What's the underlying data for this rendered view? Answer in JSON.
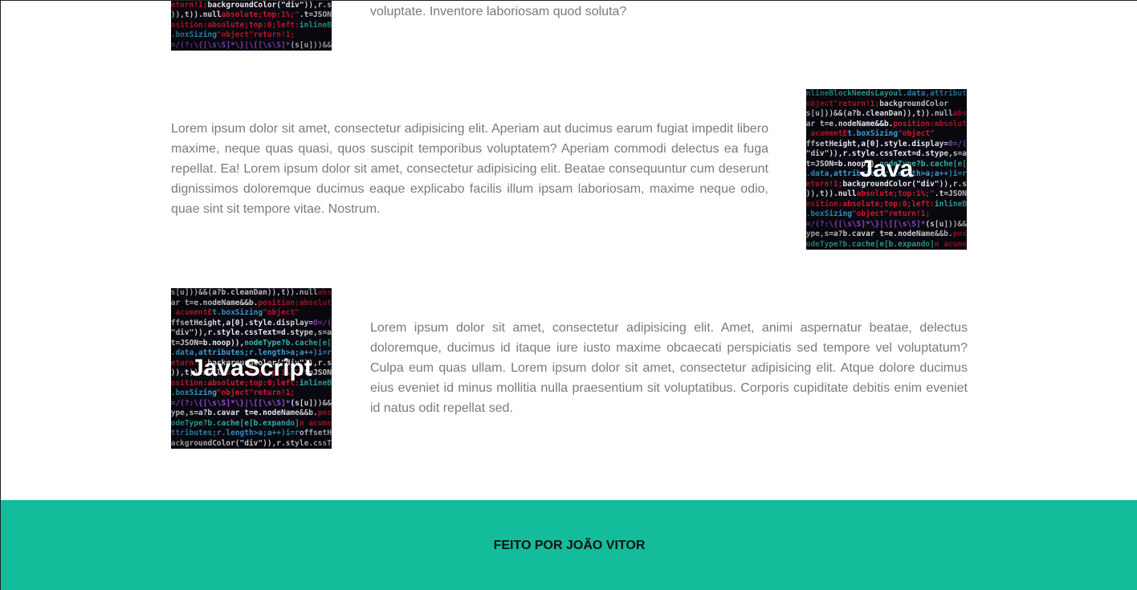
{
  "sections": [
    {
      "image_label": "",
      "text": "voluptate. Inventore laboriosam quod soluta?"
    },
    {
      "image_label": "Java",
      "text": "Lorem ipsum dolor sit amet, consectetur adipisicing elit. Aperiam aut ducimus earum fugiat impedit libero maxime, neque quas quasi, quos suscipit temporibus voluptatem? Aperiam commodi delectus ea fuga repellat. Ea! Lorem ipsum dolor sit amet, consectetur adipisicing elit. Beatae consequuntur cum deserunt dignissimos doloremque ducimus eaque explicabo facilis illum ipsam laboriosam, maxime neque odio, quae sint sit tempore vitae. Nostrum."
    },
    {
      "image_label": "JavaScript",
      "text": "Lorem ipsum dolor sit amet, consectetur adipisicing elit. Amet, animi aspernatur beatae, delectus doloremque, ducimus id itaque iure iusto maxime obcaecati perspiciatis sed tempore vel voluptatum? Culpa eum quas ullam. Lorem ipsum dolor sit amet, consectetur adipisicing elit. Atque dolore ducimus eius eveniet id minus mollitia nulla praesentium sit voluptatibus. Corporis cupiditate debitis enim eveniet id natus odit repellat sed."
    }
  ],
  "footer": {
    "text": "FEITO POR JOÃO VITOR",
    "background": "#13bc9a"
  },
  "colors": {
    "body_text": "#7a7a7a",
    "footer_text": "#111111"
  }
}
